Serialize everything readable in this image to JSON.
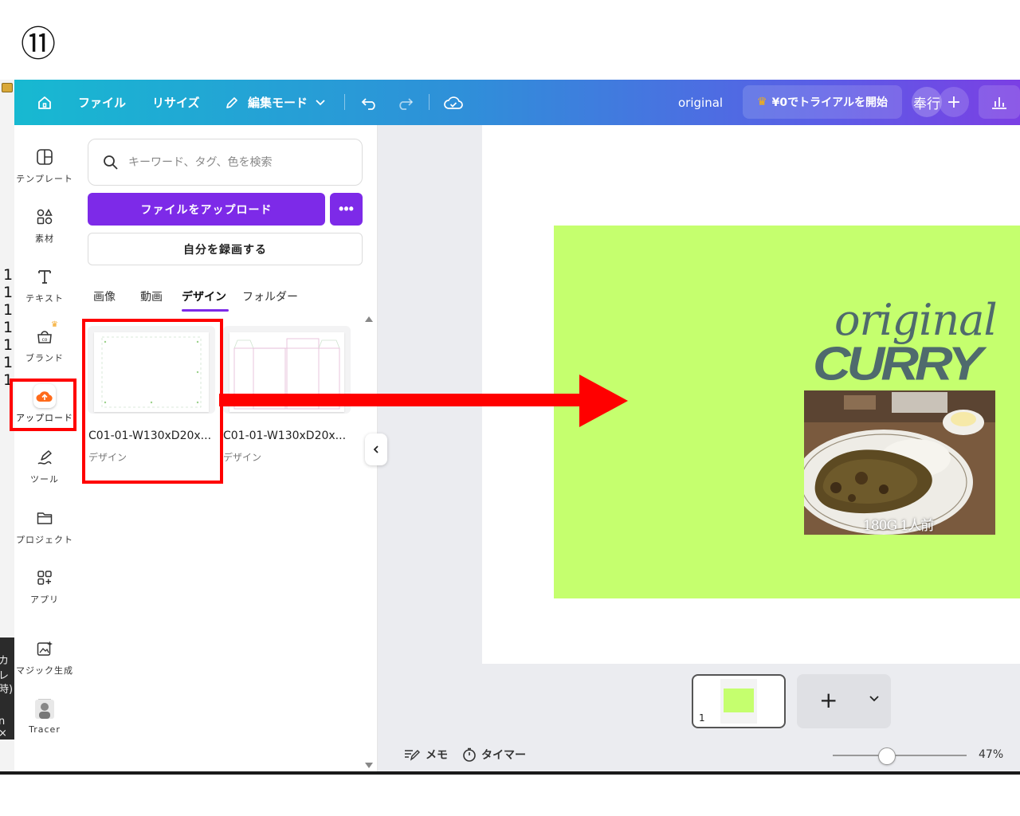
{
  "step_label": "⑪",
  "background_numbers": [
    "1",
    "1",
    "1",
    "1",
    "1",
    "1",
    "1"
  ],
  "background_snippets": [
    "カレ",
    "時)",
    "n ×"
  ],
  "topbar": {
    "file": "ファイル",
    "resize": "リサイズ",
    "edit_mode": "編集モード",
    "doc_title": "original",
    "trial_button": "¥0でトライアルを開始",
    "avatar": "奉行",
    "plus": "+",
    "icons": [
      "home-icon",
      "pencil-icon",
      "chevron-down-icon",
      "undo-icon",
      "redo-icon",
      "cloud-check-icon",
      "crown-icon",
      "analytics-icon"
    ]
  },
  "rail": {
    "items": [
      {
        "label": "テンプレート",
        "icon": "template-icon"
      },
      {
        "label": "素材",
        "icon": "elements-icon"
      },
      {
        "label": "テキスト",
        "icon": "text-icon"
      },
      {
        "label": "ブランド",
        "icon": "brand-icon"
      },
      {
        "label": "アップロード",
        "icon": "upload-icon"
      },
      {
        "label": "ツール",
        "icon": "draw-icon"
      },
      {
        "label": "プロジェクト",
        "icon": "folder-icon"
      },
      {
        "label": "アプリ",
        "icon": "apps-icon"
      },
      {
        "label": "マジック生成",
        "icon": "magic-icon"
      },
      {
        "label": "Tracer",
        "icon": "tracer-avatar"
      }
    ]
  },
  "panel": {
    "search_placeholder": "キーワード、タグ、色を検索",
    "upload_button": "ファイルをアップロード",
    "more_button": "•••",
    "record_button": "自分を録画する",
    "tabs": [
      "画像",
      "動画",
      "デザイン",
      "フォルダー"
    ],
    "active_tab": "デザイン",
    "files": [
      {
        "name": "C01-01-W130xD20x...",
        "type": "デザイン"
      },
      {
        "name": "C01-01-W130xD20x...",
        "type": "デザイン"
      }
    ]
  },
  "design": {
    "title_script": "original",
    "title_bold": "CURRY",
    "caption": "180G 1人前",
    "background": "#c5ff6e"
  },
  "pages": {
    "current_number": "1"
  },
  "footer": {
    "memo": "メモ",
    "timer": "タイマー",
    "zoom": "47%"
  },
  "colors": {
    "accent": "#7d2ae8",
    "annotation": "#ff0000"
  }
}
